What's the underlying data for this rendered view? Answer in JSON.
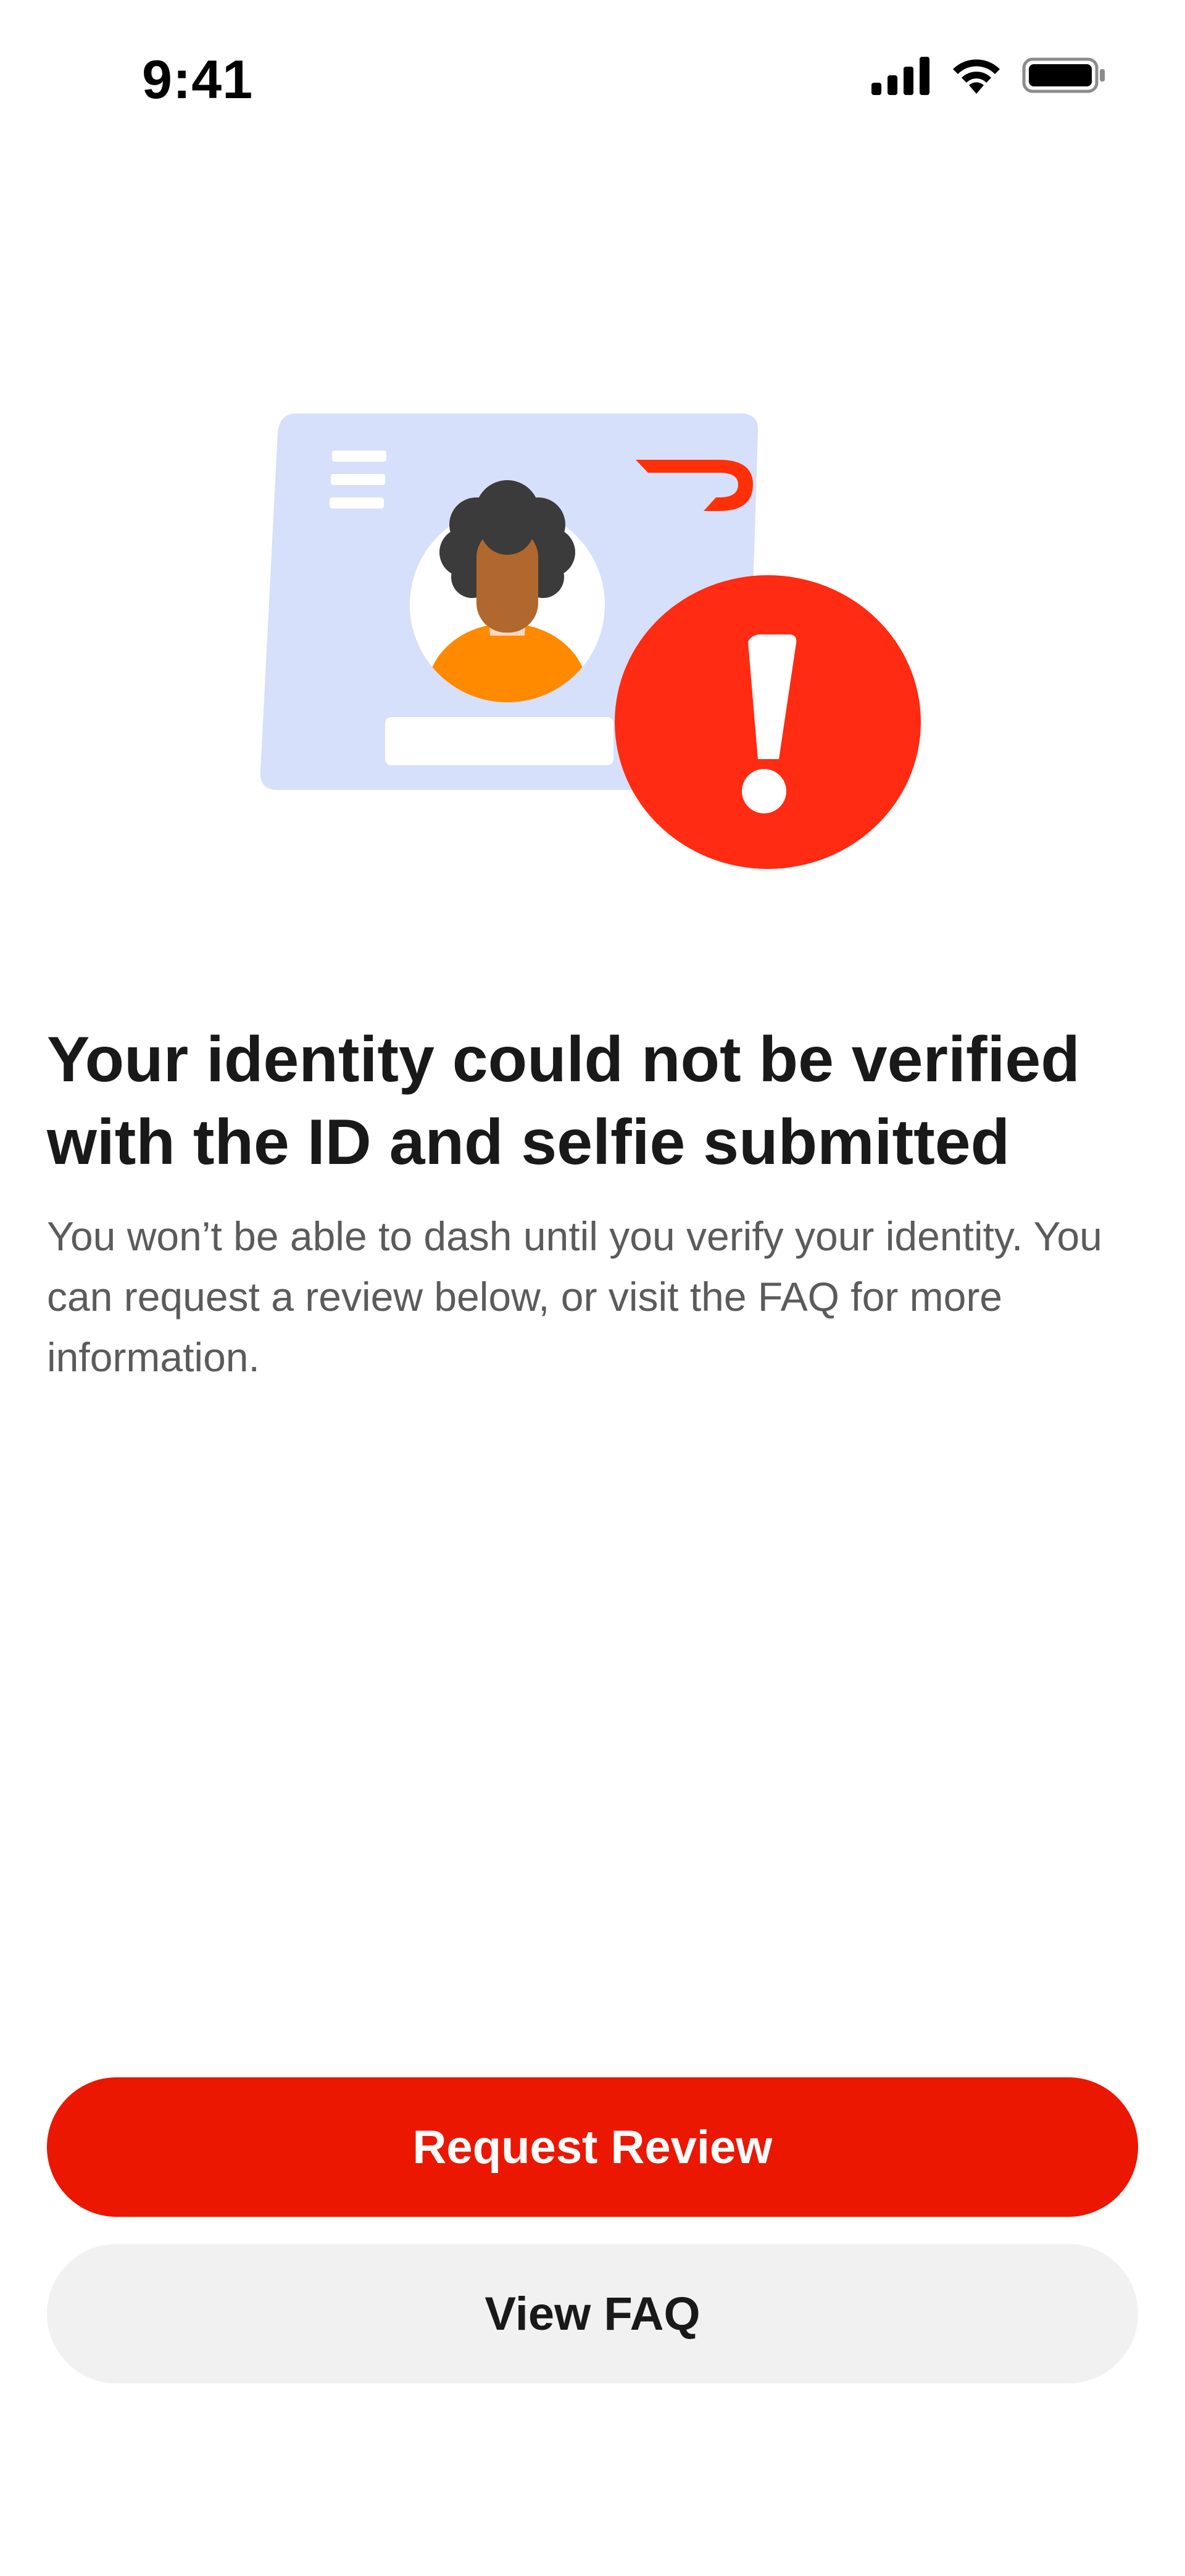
{
  "status_bar": {
    "time": "9:41"
  },
  "illustration": {
    "icons": [
      "id-card-icon",
      "doordash-logo-icon",
      "avatar-icon",
      "alert-exclamation-icon"
    ],
    "colors": {
      "card": "#d6e0fb",
      "alert": "#ff2b12",
      "brand": "#ff3008",
      "hair": "#3b3b3b",
      "skin": "#b0682e",
      "shirt": "#ff8a00"
    }
  },
  "content": {
    "title": "Your identity could not be verified with the ID and selfie submitted",
    "subtitle": "You won’t be able to dash until you verify your identity. You can request a review below, or visit the FAQ for more information."
  },
  "actions": {
    "primary_label": "Request Review",
    "secondary_label": "View FAQ"
  },
  "theme": {
    "primary": "#eb1700",
    "secondary_bg": "#f1f1f1"
  }
}
